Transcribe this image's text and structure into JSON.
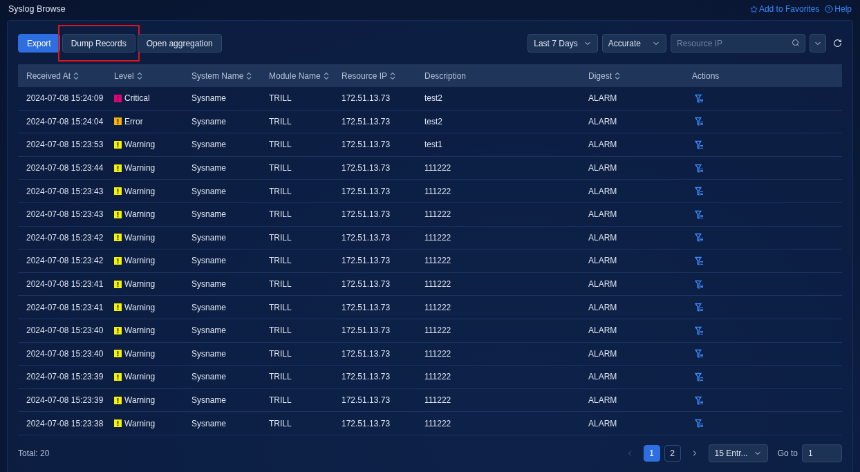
{
  "page_title": "Syslog Browse",
  "top_links": [
    {
      "kind": "favorites",
      "label": "Add to Favorites"
    },
    {
      "kind": "help",
      "label": "Help"
    }
  ],
  "toolbar": {
    "buttons": [
      {
        "label": "Export",
        "primary": true,
        "highlighted": false
      },
      {
        "label": "Dump Records",
        "primary": false,
        "highlighted": true
      },
      {
        "label": "Open aggregation",
        "primary": false,
        "highlighted": false
      }
    ],
    "time_range": "Last 7 Days",
    "match_mode": "Accurate",
    "search": {
      "placeholder": "Resource IP"
    }
  },
  "table": {
    "columns": [
      {
        "label": "Received At",
        "sortable": true
      },
      {
        "label": "Level",
        "sortable": true
      },
      {
        "label": "System Name",
        "sortable": true
      },
      {
        "label": "Module Name",
        "sortable": true
      },
      {
        "label": "Resource IP",
        "sortable": true
      },
      {
        "label": "Description",
        "sortable": false
      },
      {
        "label": "Digest",
        "sortable": true
      },
      {
        "label": "Actions",
        "sortable": false
      }
    ],
    "rows": [
      {
        "received_at": "2024-07-08 15:24:09",
        "level": "Critical",
        "color": "#e6007e",
        "system_name": "Sysname",
        "module_name": "TRILL",
        "resource_ip": "172.51.13.73",
        "description": "test2",
        "digest": "ALARM"
      },
      {
        "received_at": "2024-07-08 15:24:04",
        "level": "Error",
        "color": "#f5b400",
        "system_name": "Sysname",
        "module_name": "TRILL",
        "resource_ip": "172.51.13.73",
        "description": "test2",
        "digest": "ALARM"
      },
      {
        "received_at": "2024-07-08 15:23:53",
        "level": "Warning",
        "color": "#f5f500",
        "system_name": "Sysname",
        "module_name": "TRILL",
        "resource_ip": "172.51.13.73",
        "description": "test1",
        "digest": "ALARM"
      },
      {
        "received_at": "2024-07-08 15:23:44",
        "level": "Warning",
        "color": "#f5f500",
        "system_name": "Sysname",
        "module_name": "TRILL",
        "resource_ip": "172.51.13.73",
        "description": "111222",
        "digest": "ALARM"
      },
      {
        "received_at": "2024-07-08 15:23:43",
        "level": "Warning",
        "color": "#f5f500",
        "system_name": "Sysname",
        "module_name": "TRILL",
        "resource_ip": "172.51.13.73",
        "description": "111222",
        "digest": "ALARM"
      },
      {
        "received_at": "2024-07-08 15:23:43",
        "level": "Warning",
        "color": "#f5f500",
        "system_name": "Sysname",
        "module_name": "TRILL",
        "resource_ip": "172.51.13.73",
        "description": "111222",
        "digest": "ALARM"
      },
      {
        "received_at": "2024-07-08 15:23:42",
        "level": "Warning",
        "color": "#f5f500",
        "system_name": "Sysname",
        "module_name": "TRILL",
        "resource_ip": "172.51.13.73",
        "description": "111222",
        "digest": "ALARM"
      },
      {
        "received_at": "2024-07-08 15:23:42",
        "level": "Warning",
        "color": "#f5f500",
        "system_name": "Sysname",
        "module_name": "TRILL",
        "resource_ip": "172.51.13.73",
        "description": "111222",
        "digest": "ALARM"
      },
      {
        "received_at": "2024-07-08 15:23:41",
        "level": "Warning",
        "color": "#f5f500",
        "system_name": "Sysname",
        "module_name": "TRILL",
        "resource_ip": "172.51.13.73",
        "description": "111222",
        "digest": "ALARM"
      },
      {
        "received_at": "2024-07-08 15:23:41",
        "level": "Warning",
        "color": "#f5f500",
        "system_name": "Sysname",
        "module_name": "TRILL",
        "resource_ip": "172.51.13.73",
        "description": "111222",
        "digest": "ALARM"
      },
      {
        "received_at": "2024-07-08 15:23:40",
        "level": "Warning",
        "color": "#f5f500",
        "system_name": "Sysname",
        "module_name": "TRILL",
        "resource_ip": "172.51.13.73",
        "description": "111222",
        "digest": "ALARM"
      },
      {
        "received_at": "2024-07-08 15:23:40",
        "level": "Warning",
        "color": "#f5f500",
        "system_name": "Sysname",
        "module_name": "TRILL",
        "resource_ip": "172.51.13.73",
        "description": "111222",
        "digest": "ALARM"
      },
      {
        "received_at": "2024-07-08 15:23:39",
        "level": "Warning",
        "color": "#f5f500",
        "system_name": "Sysname",
        "module_name": "TRILL",
        "resource_ip": "172.51.13.73",
        "description": "111222",
        "digest": "ALARM"
      },
      {
        "received_at": "2024-07-08 15:23:39",
        "level": "Warning",
        "color": "#f5f500",
        "system_name": "Sysname",
        "module_name": "TRILL",
        "resource_ip": "172.51.13.73",
        "description": "111222",
        "digest": "ALARM"
      },
      {
        "received_at": "2024-07-08 15:23:38",
        "level": "Warning",
        "color": "#f5f500",
        "system_name": "Sysname",
        "module_name": "TRILL",
        "resource_ip": "172.51.13.73",
        "description": "111222",
        "digest": "ALARM"
      }
    ]
  },
  "footer": {
    "total": "Total: 20",
    "pages": [
      {
        "label": "1",
        "selected": true
      },
      {
        "label": "2",
        "selected": false
      }
    ],
    "page_size": "15 Entr...",
    "goto_label": "Go to",
    "goto_value": "1"
  }
}
